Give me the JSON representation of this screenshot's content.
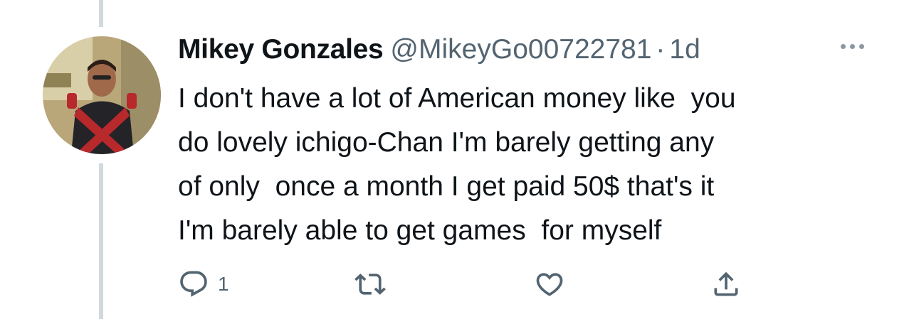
{
  "tweet": {
    "author_name": "Mikey Gonzales",
    "handle": "@MikeyGo00722781",
    "separator": "·",
    "time": "1d",
    "text_lines": [
      "I don't have a lot of American money like  you",
      "do lovely ichigo-Chan I'm barely getting any",
      "of only  once a month I get paid 50$ that's it",
      "I'm barely able to get games  for myself"
    ]
  },
  "actions": {
    "reply": {
      "icon": "reply-icon",
      "count": "1"
    },
    "retweet": {
      "icon": "retweet-icon",
      "count": ""
    },
    "like": {
      "icon": "heart-icon",
      "count": ""
    },
    "share": {
      "icon": "share-icon",
      "count": ""
    }
  },
  "colors": {
    "text": "#0f1419",
    "secondary": "#536471",
    "thread_line": "#cfd9de",
    "icon": "#536471"
  }
}
